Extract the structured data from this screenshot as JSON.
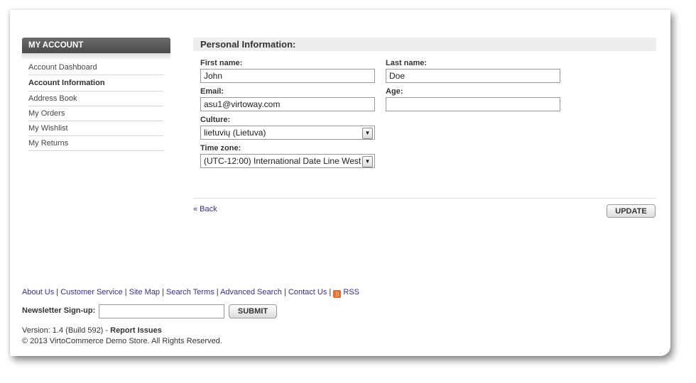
{
  "sidebar": {
    "header": "MY ACCOUNT",
    "items": [
      {
        "label": "Account Dashboard"
      },
      {
        "label": "Account Information"
      },
      {
        "label": "Address Book"
      },
      {
        "label": "My Orders"
      },
      {
        "label": "My Wishlist"
      },
      {
        "label": "My Returns"
      }
    ],
    "active": "Account Information"
  },
  "personal_info": {
    "title": "Personal Information:",
    "first_name": {
      "label": "First name:",
      "value": "John"
    },
    "last_name": {
      "label": "Last name:",
      "value": "Doe"
    },
    "email": {
      "label": "Email:",
      "value": "asu1@virtoway.com"
    },
    "age": {
      "label": "Age:",
      "value": ""
    },
    "culture": {
      "label": "Culture:",
      "value": "lietuvių (Lietuva)"
    },
    "time_zone": {
      "label": "Time zone:",
      "value": "(UTC-12:00) International Date Line West"
    }
  },
  "actions": {
    "back_label": "« Back",
    "update_label": "UPDATE"
  },
  "footer": {
    "links": [
      "About Us",
      "Customer Service",
      "Site Map",
      "Search Terms",
      "Advanced Search",
      "Contact Us",
      "RSS"
    ],
    "newsletter_label": "Newsletter Sign-up:",
    "newsletter_value": "",
    "submit_label": "SUBMIT",
    "version_text": "Version: 1.4 (Build 592) - ",
    "report_issues": "Report Issues",
    "copyright": "© 2013 VirtoCommerce Demo Store. All Rights Reserved."
  },
  "icons": {
    "select_arrow": "chevron-down-icon",
    "rss": "rss-icon"
  },
  "colors": {
    "link": "#3b2aa0",
    "sidebar_header": "#555555",
    "rss": "#f26522"
  }
}
